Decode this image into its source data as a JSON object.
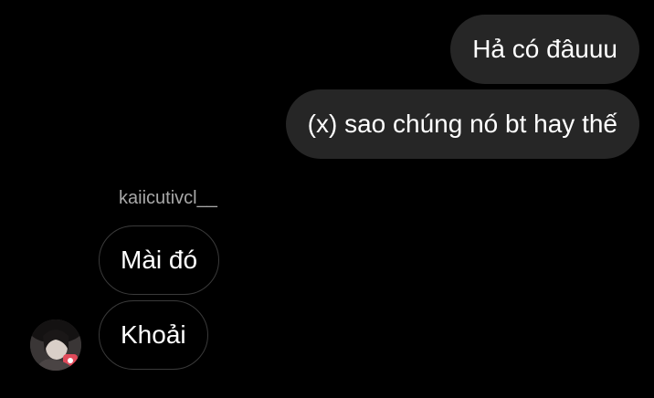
{
  "conversation": {
    "outgoing": [
      {
        "text": "Hả có đâuuu"
      },
      {
        "text": "(x) sao chúng nó bt hay thế"
      }
    ],
    "incoming_sender": "kaiicutivcl__",
    "incoming": [
      {
        "text": "Mài đó"
      },
      {
        "text": "Khoải"
      }
    ]
  },
  "colors": {
    "background": "#000000",
    "outgoing_bubble": "#262626",
    "incoming_border": "#3a3a3a",
    "sender_name": "#a8a8a8",
    "text": "#ffffff"
  },
  "icons": {
    "avatar": "profile-photo"
  }
}
